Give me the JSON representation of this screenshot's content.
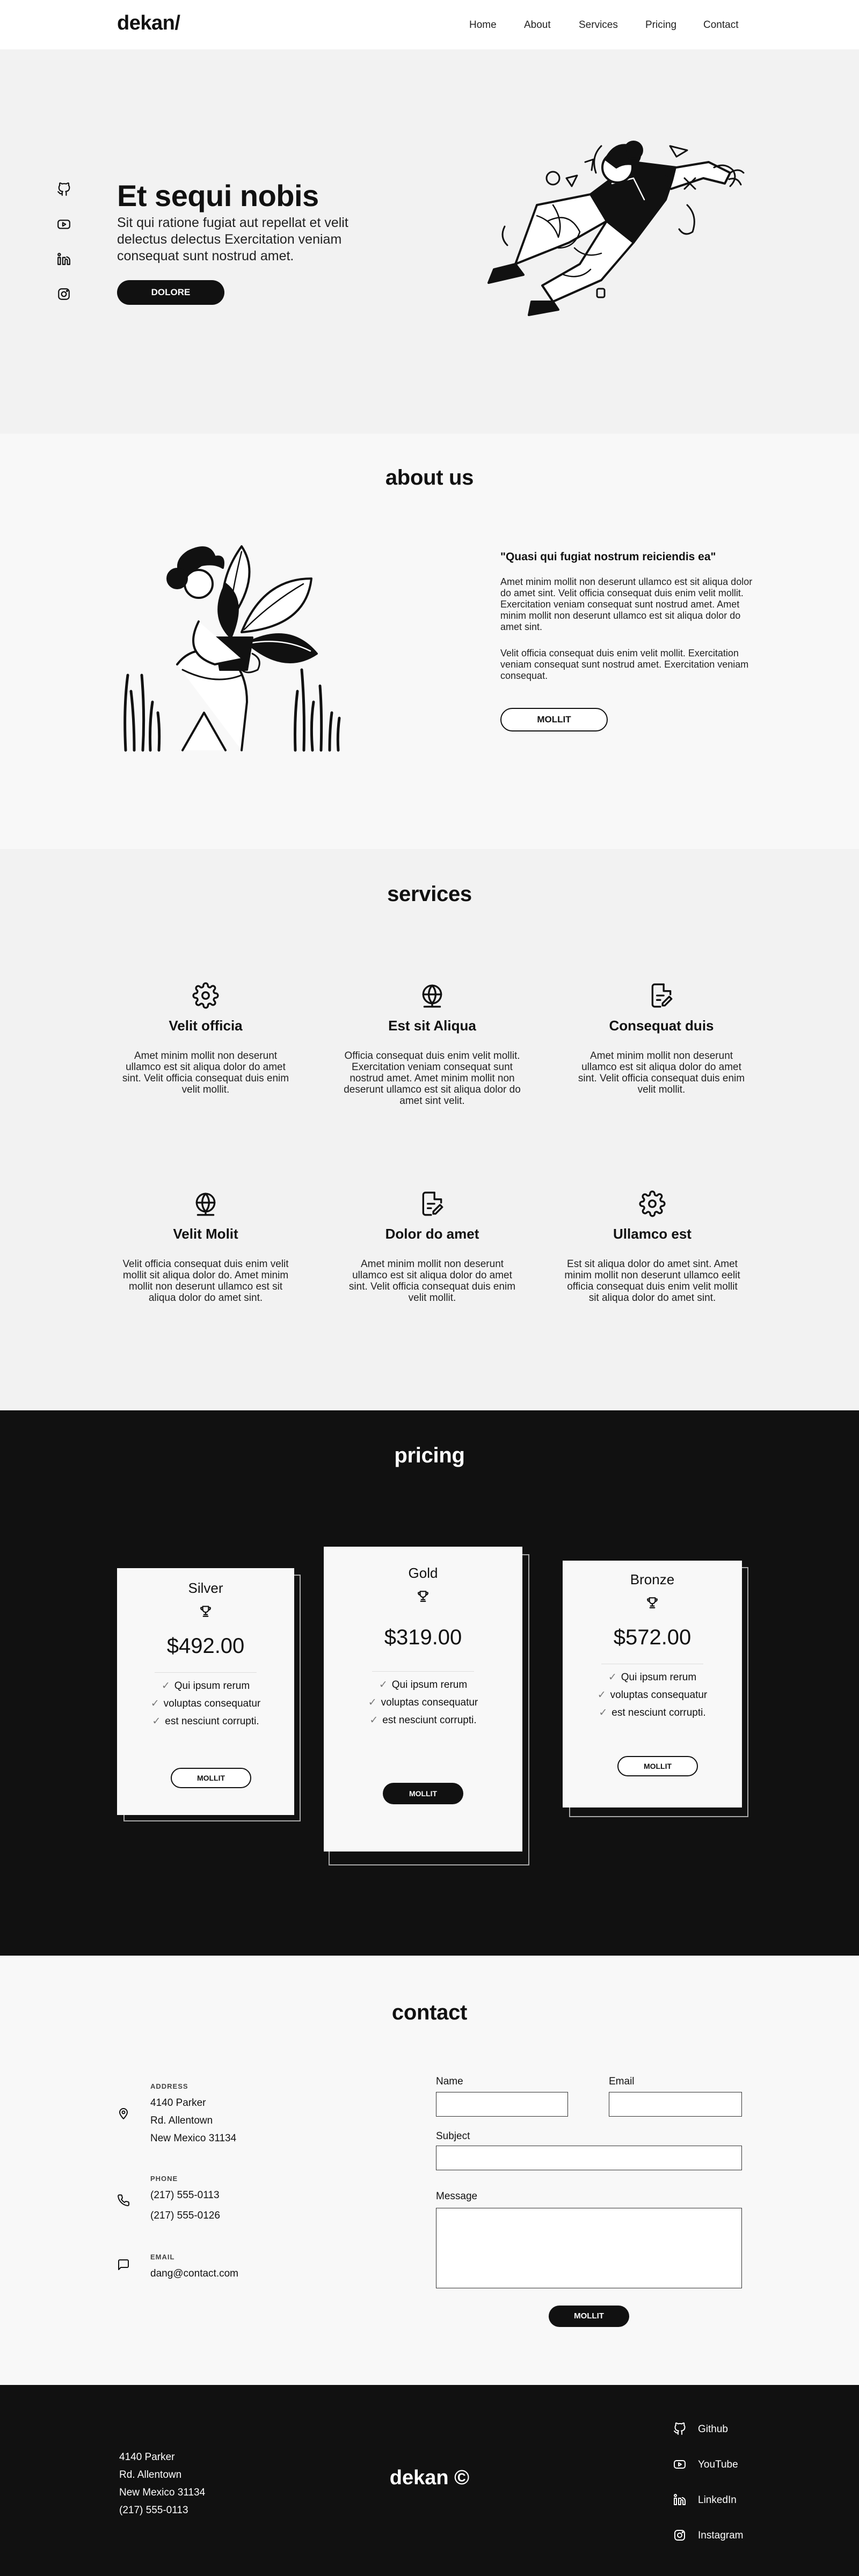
{
  "header": {
    "logo": "dekan/",
    "nav": [
      "Home",
      "About",
      "Services",
      "Pricing",
      "Contact"
    ]
  },
  "hero": {
    "title": "Et sequi nobis",
    "subtitle": "Sit qui ratione fugiat aut repellat et velit delectus delectus Exercitation veniam consequat sunt nostrud amet.",
    "button": "DOLORE",
    "social_icons": [
      "github-icon",
      "youtube-icon",
      "linkedin-icon",
      "instagram-icon"
    ]
  },
  "about": {
    "title": "about us",
    "quote": "\"Quasi qui fugiat nostrum reiciendis ea\"",
    "p1": "Amet minim mollit non deserunt ullamco est sit aliqua dolor do amet sint.  Velit officia consequat duis enim velit mollit. Exercitation veniam consequat sunt nostrud amet. Amet minim mollit non deserunt ullamco est sit aliqua dolor do amet sint.",
    "p2": "Velit officia consequat duis enim velit mollit. Exercitation veniam consequat sunt nostrud amet. Exercitation veniam consequat.",
    "button": "MOLLIT"
  },
  "services": {
    "title": "services",
    "items": [
      {
        "icon": "gear-icon",
        "title": "Velit officia",
        "text": "Amet minim mollit non deserunt ullamco est sit aliqua dolor do amet sint.  Velit officia consequat duis enim velit mollit."
      },
      {
        "icon": "globe-icon",
        "title": "Est sit Aliqua",
        "text": "Officia consequat duis enim velit mollit. Exercitation veniam consequat sunt nostrud amet. Amet minim mollit non deserunt ullamco est sit aliqua dolor do amet sint velit."
      },
      {
        "icon": "document-edit-icon",
        "title": "Consequat duis",
        "text": "Amet minim mollit non deserunt ullamco est sit aliqua dolor do amet sint.  Velit officia consequat duis enim velit mollit."
      },
      {
        "icon": "globe-icon",
        "title": "Velit Molit",
        "text": "Velit officia consequat duis enim velit mollit sit aliqua dolor do. Amet minim mollit non deserunt ullamco est sit aliqua dolor do amet sint."
      },
      {
        "icon": "document-edit-icon",
        "title": "Dolor do amet",
        "text": "Amet minim mollit non deserunt ullamco est sit aliqua dolor do amet sint.  Velit officia consequat duis enim velit mollit."
      },
      {
        "icon": "gear-icon",
        "title": "Ullamco est",
        "text": "Est sit aliqua dolor do amet sint. Amet minim mollit non deserunt ullamco eelit officia consequat duis enim velit mollit sit aliqua dolor do amet sint."
      }
    ]
  },
  "pricing": {
    "title": "pricing",
    "plans": [
      {
        "name": "Silver",
        "icon": "trophy-icon",
        "price": "$492.00",
        "features": [
          "Qui ipsum rerum",
          "voluptas consequatur",
          "est nesciunt corrupti."
        ],
        "button": "MOLLIT",
        "highlight": false
      },
      {
        "name": "Gold",
        "icon": "trophy-icon",
        "price": "$319.00",
        "features": [
          "Qui ipsum rerum",
          "voluptas consequatur",
          "est nesciunt corrupti."
        ],
        "button": "MOLLIT",
        "highlight": true
      },
      {
        "name": "Bronze",
        "icon": "trophy-icon",
        "price": "$572.00",
        "features": [
          "Qui ipsum rerum",
          "voluptas consequatur",
          "est nesciunt corrupti."
        ],
        "button": "MOLLIT",
        "highlight": false
      }
    ]
  },
  "contact": {
    "title": "contact",
    "address_label": "ADDRESS",
    "address_lines": [
      "4140 Parker",
      "Rd. Allentown",
      "New Mexico 31134"
    ],
    "phone_label": "PHONE",
    "phones": [
      "(217) 555-0113",
      "(217) 555-0126"
    ],
    "email_label": "EMAIL",
    "email": "dang@contact.com",
    "form": {
      "name_label": "Name",
      "email_label": "Email",
      "subject_label": "Subject",
      "message_label": "Message",
      "submit": "MOLLIT"
    }
  },
  "footer": {
    "address_lines": [
      "4140 Parker",
      "Rd. Allentown",
      "New Mexico 31134",
      "(217) 555-0113"
    ],
    "brand": "dekan ©",
    "social": [
      {
        "icon": "github-icon",
        "label": "Github"
      },
      {
        "icon": "youtube-icon",
        "label": "YouTube"
      },
      {
        "icon": "linkedin-icon",
        "label": "LinkedIn"
      },
      {
        "icon": "instagram-icon",
        "label": "Instagram"
      }
    ]
  }
}
